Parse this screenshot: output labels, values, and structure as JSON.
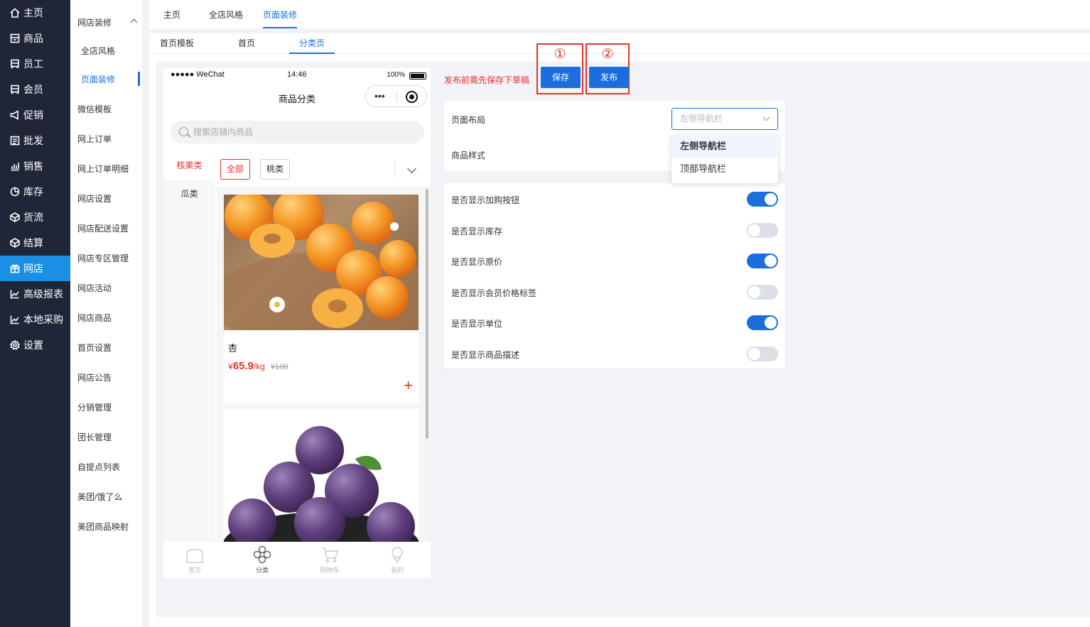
{
  "nav": [
    {
      "label": "主页",
      "icon": "home-icon"
    },
    {
      "label": "商品",
      "icon": "goods-icon"
    },
    {
      "label": "员工",
      "icon": "staff-icon"
    },
    {
      "label": "会员",
      "icon": "member-icon"
    },
    {
      "label": "促销",
      "icon": "promo-icon"
    },
    {
      "label": "批发",
      "icon": "wholesale-icon"
    },
    {
      "label": "销售",
      "icon": "sales-icon"
    },
    {
      "label": "库存",
      "icon": "stock-icon"
    },
    {
      "label": "货流",
      "icon": "cargo-icon"
    },
    {
      "label": "结算",
      "icon": "settle-icon"
    },
    {
      "label": "网店",
      "icon": "gift-icon",
      "active": true
    },
    {
      "label": "高级报表",
      "icon": "report-icon"
    },
    {
      "label": "本地采购",
      "icon": "purchase-icon"
    },
    {
      "label": "设置",
      "icon": "gear-icon"
    }
  ],
  "submenu": {
    "header": "网店装修",
    "items": [
      "全店风格",
      "页面装修",
      "微信模板",
      "网上订单",
      "网上订单明细",
      "网店设置",
      "网店配送设置",
      "网店专区管理",
      "网店活动",
      "网店商品",
      "首页设置",
      "网店公告",
      "分销管理",
      "团长管理",
      "自提点列表",
      "美团/饿了么",
      "美团商品映射"
    ],
    "active_index": 1
  },
  "top_tabs": [
    "主页",
    "全店风格",
    "页面装修"
  ],
  "sub_tabs": [
    "首页模板",
    "首页",
    "分类页"
  ],
  "phone": {
    "carrier": "●●●●● WeChat",
    "time": "14:46",
    "battery": "100%",
    "title": "商品分类",
    "capsule_dots": "•••",
    "search_placeholder": "搜索店铺内商品",
    "categories": [
      "核果类",
      "瓜类"
    ],
    "chips": [
      "全部",
      "桃类"
    ],
    "goods": [
      {
        "name": "杏",
        "currency": "¥",
        "price": "65.9",
        "unit": "/kg",
        "old_price": "¥100",
        "plus": "+"
      }
    ],
    "tabbar": [
      "首页",
      "分类",
      "购物车",
      "我的"
    ]
  },
  "notice": "发布前需先保存下草稿",
  "markers": [
    "①",
    "②"
  ],
  "buttons": {
    "save": "保存",
    "publish": "发布"
  },
  "layout_panel": {
    "layout_label": "页面布局",
    "layout_value": "左侧导航栏",
    "style_label": "商品样式",
    "options": [
      "左侧导航栏",
      "顶部导航栏"
    ]
  },
  "toggles": [
    {
      "label": "是否显示加购按钮",
      "on": true
    },
    {
      "label": "是否显示库存",
      "on": false
    },
    {
      "label": "是否显示原价",
      "on": true
    },
    {
      "label": "是否显示会员价格标签",
      "on": false
    },
    {
      "label": "是否显示单位",
      "on": true
    },
    {
      "label": "是否显示商品描述",
      "on": false
    }
  ],
  "colors": {
    "primary": "#1a6fdc",
    "accent_red": "#e5322d",
    "nav_bg": "#1f2637",
    "nav_active": "#1a8fe3"
  }
}
